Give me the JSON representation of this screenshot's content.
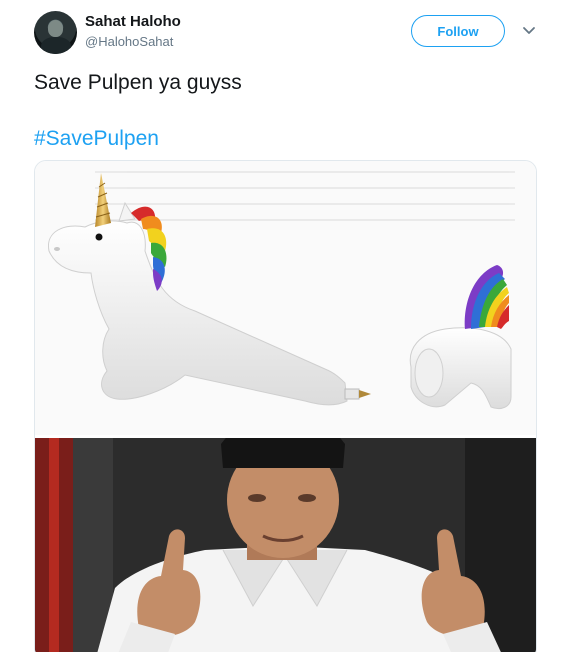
{
  "author": {
    "name": "Sahat Haloho",
    "handle": "@HalohoSahat"
  },
  "follow_button": {
    "label": "Follow"
  },
  "menu": {
    "icon": "chevron-down-icon"
  },
  "tweet": {
    "text": "Save Pulpen ya guyss",
    "hashtag": "#SavePulpen"
  },
  "media": {
    "photos": [
      {
        "icon": "unicorn-pen-image"
      },
      {
        "icon": "person-thumbs-up-image"
      }
    ]
  },
  "colors": {
    "accent": "#1da1f2",
    "text": "#14171a",
    "secondary": "#657786",
    "border": "#e1e8ed"
  }
}
